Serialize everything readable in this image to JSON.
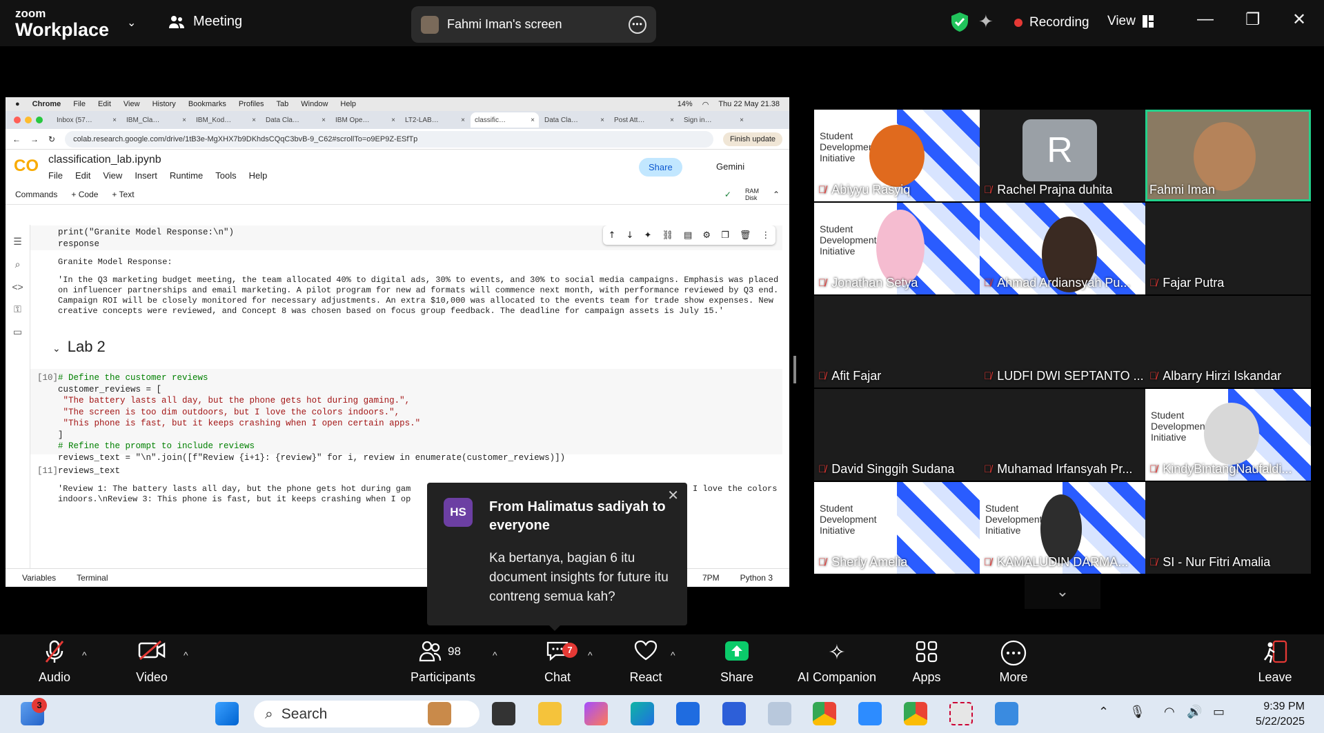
{
  "zoom": {
    "brand_small": "zoom",
    "brand_big": "Workplace",
    "meeting_label": "Meeting",
    "screen_title": "Fahmi Iman's screen",
    "recording_label": "Recording",
    "view_label": "View"
  },
  "mac_menubar": {
    "items": [
      "Chrome",
      "File",
      "Edit",
      "View",
      "History",
      "Bookmarks",
      "Profiles",
      "Tab",
      "Window",
      "Help"
    ],
    "battery": "14%",
    "datetime": "Thu 22 May 21.38"
  },
  "chrome": {
    "tabs": [
      "Inbox (57…",
      "IBM_Cla…",
      "IBM_Kod…",
      "Data Cla…",
      "IBM Ope…",
      "LT2-LAB…",
      "classific…",
      "Data Cla…",
      "Post Att…",
      "Sign in…"
    ],
    "url": "colab.research.google.com/drive/1tB3e-MgXHX7b9DKhdsCQqC3bvB-9_C62#scrollTo=o9EP9Z-ESfTp",
    "finish_update": "Finish update"
  },
  "colab": {
    "logo": "CO",
    "notebook_title": "classification_lab.ipynb",
    "menu": [
      "File",
      "Edit",
      "View",
      "Insert",
      "Runtime",
      "Tools",
      "Help"
    ],
    "share_label": "Share",
    "gemini_label": "Gemini",
    "commands_label": "Commands",
    "add_code": "+ Code",
    "add_text": "+ Text",
    "ram_label": "RAM",
    "disk_label": "Disk",
    "cell1_line1": "print(\"Granite Model Response:\\n\")",
    "cell1_line2": "response",
    "output1_header": "Granite Model Response:",
    "output1_text": "'In the Q3 marketing budget meeting, the team allocated 40% to digital ads, 30% to events, and 30% to social media campaigns. Emphasis was placed on influencer partnerships and email marketing. A pilot program for new ad formats will commence next month, with performance reviewed by Q3 end. Campaign ROI will be closely monitored for necessary adjustments. An extra $10,000 was allocated to the events team for trade show expenses. New creative concepts were reviewed, and Concept 8 was chosen based on focus group feedback. The deadline for campaign assets is July 15.'",
    "section_title": "Lab 2",
    "cell10_prompt": "[10]",
    "cell10_c1": "# Define the customer reviews",
    "cell10_l2": "customer_reviews = [",
    "cell10_s1": "\"The battery lasts all day, but the phone gets hot during gaming.\",",
    "cell10_s2": "\"The screen is too dim outdoors, but I love the colors indoors.\",",
    "cell10_s3": "\"This phone is fast, but it keeps crashing when I open certain apps.\"",
    "cell10_l6": "]",
    "cell10_c2": "# Refine the prompt to include reviews",
    "cell10_l8": "reviews_text = \"\\n\".join([f\"Review {i+1}: {review}\" for i, review in enumerate(customer_reviews)])",
    "cell11_prompt": "[11]",
    "cell11_code": "reviews_text",
    "output11_line1": "'Review 1: The battery lasts all day, but the phone gets hot during gam",
    "output11_line1_end": "I love the colors",
    "output11_line2": "indoors.\\nReview 3: This phone is fast, but it keeps crashing when I op",
    "status_variables": "Variables",
    "status_terminal": "Terminal",
    "status_time": "7PM",
    "status_kernel": "Python 3"
  },
  "toast": {
    "initials": "HS",
    "from": "From Halimatus sadiyah to everyone",
    "message": "Ka bertanya, bagian 6 itu document insights for future itu contreng semua kah?"
  },
  "gallery": {
    "sdi_text": "Student Development Initiative",
    "r_initial": "R",
    "participants": [
      "Abiyyu Rasyiq",
      "Rachel Prajna duhita",
      "Fahmi Iman",
      "Jonathan Setya",
      "Ahmad Ardiansyah Pu...",
      "Fajar Putra",
      "Afit Fajar",
      "LUDFI DWI SEPTANTO ...",
      "Albarry Hirzi Iskandar",
      "David Singgih Sudana",
      "Muhamad Irfansyah Pr...",
      "KindyBintangNaufaldi...",
      "Sherly Amelia",
      "KAMALUDIN DARMA...",
      "SI - Nur Fitri Amalia"
    ]
  },
  "toolbar": {
    "audio": "Audio",
    "video": "Video",
    "participants": "Participants",
    "participants_count": "98",
    "chat": "Chat",
    "chat_badge": "7",
    "react": "React",
    "share": "Share",
    "ai": "AI Companion",
    "apps": "Apps",
    "more": "More",
    "leave": "Leave"
  },
  "taskbar": {
    "search": "Search",
    "widget_badge": "3",
    "time": "9:39 PM",
    "date": "5/22/2025"
  },
  "colors": {
    "zoom_bg": "#121212",
    "speaker_border": "#23d18b",
    "recording": "#e53935",
    "share_green": "#0bca6a"
  }
}
